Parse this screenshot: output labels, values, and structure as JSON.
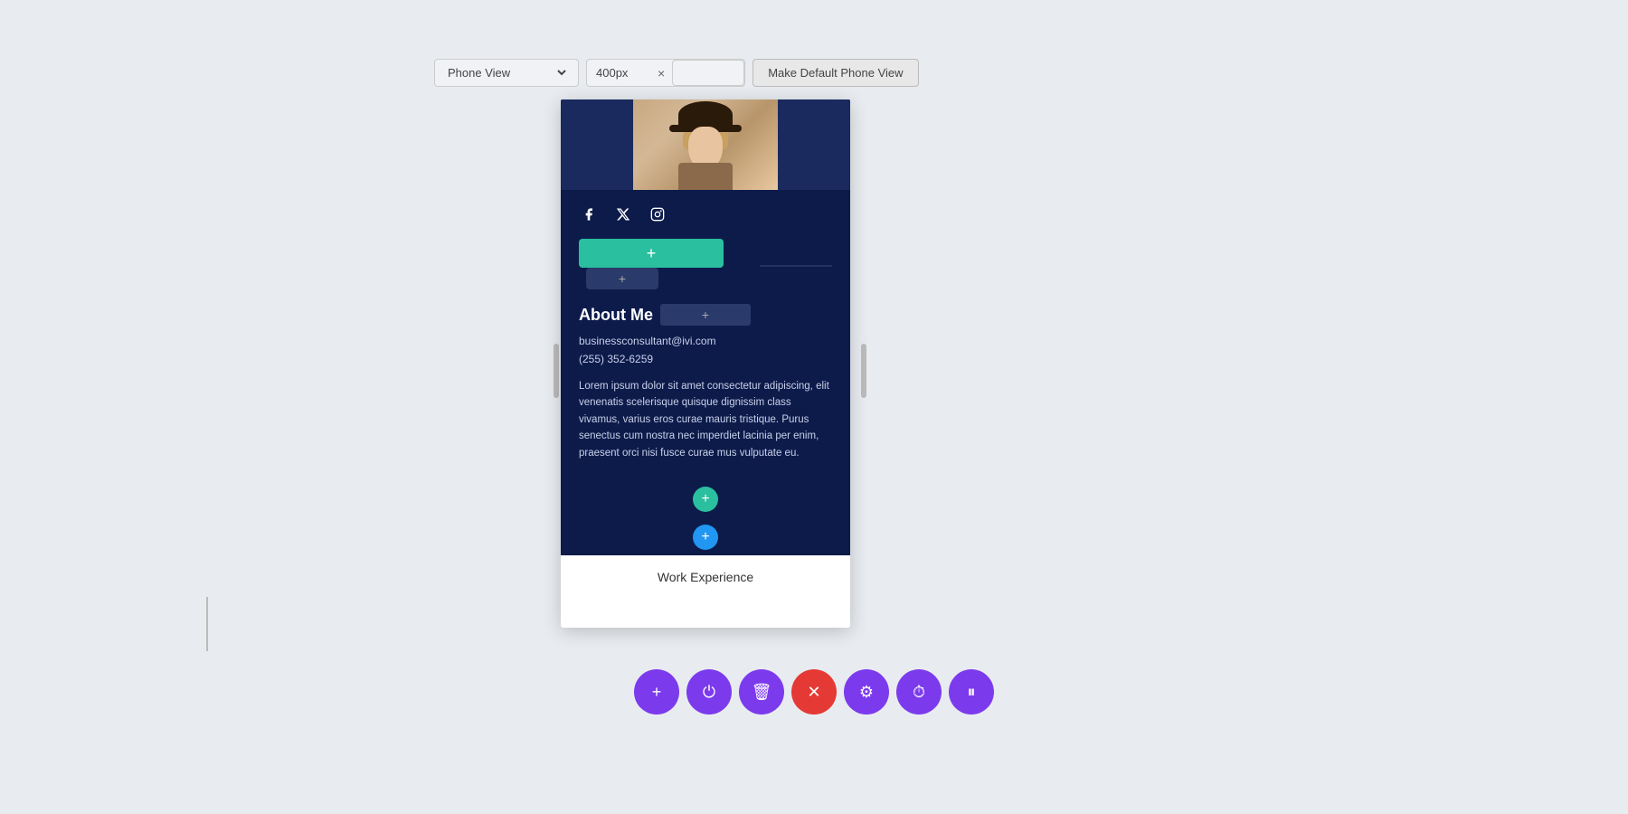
{
  "toolbar": {
    "view_select_label": "Phone View",
    "width_value": "400px",
    "make_default_label": "Make Default Phone View",
    "clear_icon": "×"
  },
  "profile": {
    "social_icons": [
      "f",
      "𝕏",
      "⊡"
    ],
    "email": "businessconsultant@ivi.com",
    "phone": "(255) 352-6259",
    "about_title": "About Me",
    "bio": "Lorem ipsum dolor sit amet consectetur adipiscing, elit venenatis scelerisque quisque dignissim class vivamus, varius eros curae mauris tristique. Purus senectus cum nostra nec imperdiet lacinia per enim, praesent orci nisi fusce curae mus vulputate eu.",
    "work_section_label": "Work Experience"
  },
  "bottom_toolbar": {
    "add_icon": "+",
    "power_icon": "⏻",
    "trash_icon": "🗑",
    "close_icon": "×",
    "settings_icon": "⚙",
    "clock_icon": "⏱",
    "pause_icon": "⏸"
  }
}
